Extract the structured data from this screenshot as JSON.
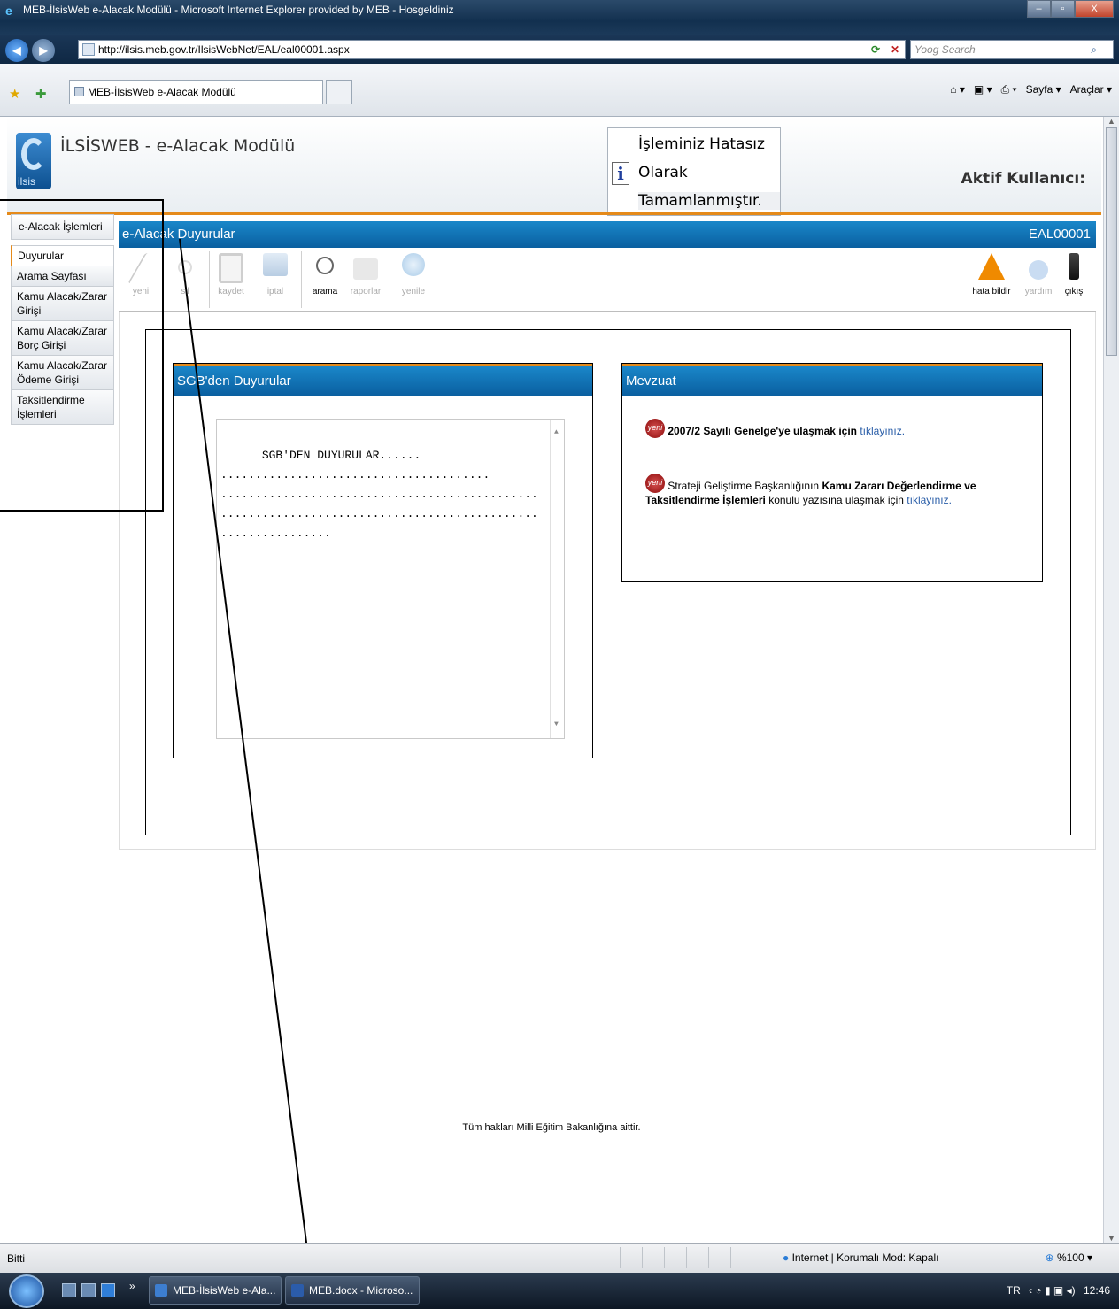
{
  "window": {
    "title": "MEB-İlsisWeb e-Alacak Modülü - Microsoft Internet Explorer provided by MEB - Hosgeldiniz",
    "minimize": "–",
    "maximize": "▫",
    "close": "X"
  },
  "address": {
    "url": "http://ilsis.meb.gov.tr/IlsisWebNet/EAL/eal00001.aspx",
    "search_placeholder": "Yoog Search"
  },
  "tabs": [
    {
      "label": "MEB-İlsisWeb e-Alacak Modülü"
    }
  ],
  "commandbar": {
    "page": "Sayfa ▾",
    "tools": "Araçlar ▾"
  },
  "header": {
    "logo_text": "ilsis",
    "app_title": "İLSİSWEB - e-Alacak Modülü",
    "message_lines": [
      "İşleminiz Hatasız",
      "Olarak",
      "Tamamlanmıştır."
    ],
    "active_user_label": "Aktif Kullanıcı:"
  },
  "sidebar": {
    "heading": "e-Alacak İşlemleri",
    "items": [
      {
        "label": "Duyurular"
      },
      {
        "label": "Arama Sayfası"
      },
      {
        "label": "Kamu Alacak/Zarar Girişi"
      },
      {
        "label": "Kamu Alacak/Zarar Borç Girişi"
      },
      {
        "label": "Kamu Alacak/Zarar Ödeme Girişi"
      },
      {
        "label": "Taksitlendirme İşlemleri"
      }
    ]
  },
  "panel": {
    "title": "e-Alacak Duyurular",
    "code": "EAL00001"
  },
  "toolbar": {
    "buttons": [
      {
        "label": "yeni",
        "icon": "pencil-icon"
      },
      {
        "label": "sil",
        "icon": "scissors-icon"
      },
      {
        "label": "kaydet",
        "icon": "floppy-icon"
      },
      {
        "label": "iptal",
        "icon": "monitor-icon"
      },
      {
        "label": "arama",
        "icon": "magnifier-icon"
      },
      {
        "label": "raporlar",
        "icon": "printer-icon"
      },
      {
        "label": "yenile",
        "icon": "globe-icon"
      }
    ],
    "right_buttons": [
      {
        "label": "hata bildir",
        "icon": "warning-icon"
      },
      {
        "label": "yardım",
        "icon": "help-icon"
      },
      {
        "label": "çıkış",
        "icon": "exit-icon"
      }
    ]
  },
  "announcements": {
    "title": "SGB'den Duyurular",
    "text": "SGB'DEN DUYURULAR......\n.......................................\n..............................................\n..............................................\n................"
  },
  "mevzuat": {
    "title": "Mevzuat",
    "badge": "yeni",
    "item1_bold": "2007/2 Sayılı Genelge'ye ulaşmak için",
    "item1_link": "tıklayınız.",
    "item2_pre": "Strateji Geliştirme Başkanlığının",
    "item2_bold": "Kamu Zararı Değerlendirme ve Taksitlendirme İşlemleri",
    "item2_post": "konulu yazısına ulaşmak için",
    "item2_link": "tıklayınız."
  },
  "footer": {
    "text": "Tüm hakları Milli Eğitim Bakanlığına aittir."
  },
  "statusbar": {
    "left": "Bitti",
    "zone": "Internet | Korumalı Mod: Kapalı",
    "zoom": "%100"
  },
  "taskbar": {
    "tasks": [
      {
        "label": "MEB-İlsisWeb e-Ala..."
      },
      {
        "label": "MEB.docx - Microso..."
      }
    ],
    "lang": "TR",
    "time": "12:46"
  },
  "colors": {
    "panel_blue": "#0a5fa0",
    "accent_orange": "#e58a1a",
    "link_blue": "#2a5ea8"
  }
}
